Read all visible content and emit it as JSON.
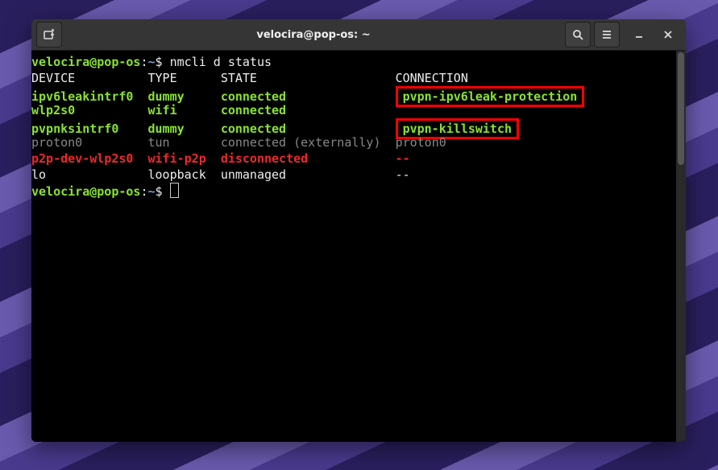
{
  "window": {
    "title": "velocira@pop-os: ~"
  },
  "prompt": {
    "user_host": "velocira@pop-os",
    "sep1": ":",
    "cwd": "~",
    "sep2": "$ "
  },
  "command": "nmcli d status",
  "headers": {
    "device": "DEVICE",
    "type": "TYPE",
    "state": "STATE",
    "connection": "CONNECTION"
  },
  "rows": [
    {
      "device": "ipv6leakintrf0",
      "type": "dummy",
      "state": "connected",
      "connection": "pvpn-ipv6leak-protection",
      "style": "green",
      "hl": true
    },
    {
      "device": "wlp2s0",
      "type": "wifi",
      "state": "connected",
      "connection": "",
      "style": "green",
      "hl": false
    },
    {
      "device": "pvpnksintrf0",
      "type": "dummy",
      "state": "connected",
      "connection": "pvpn-killswitch",
      "style": "green",
      "hl": true
    },
    {
      "device": "proton0",
      "type": "tun",
      "state": "connected (externally)",
      "connection": "proton0",
      "style": "dim",
      "hl": false
    },
    {
      "device": "p2p-dev-wlp2s0",
      "type": "wifi-p2p",
      "state": "disconnected",
      "connection": "--",
      "style": "red",
      "hl": false
    },
    {
      "device": "lo",
      "type": "loopback",
      "state": "unmanaged",
      "connection": "--",
      "style": "plain",
      "hl": false
    }
  ],
  "chart_data": {
    "type": "table",
    "title": "nmcli d status",
    "columns": [
      "DEVICE",
      "TYPE",
      "STATE",
      "CONNECTION"
    ],
    "rows": [
      [
        "ipv6leakintrf0",
        "dummy",
        "connected",
        "pvpn-ipv6leak-protection"
      ],
      [
        "wlp2s0",
        "wifi",
        "connected",
        ""
      ],
      [
        "pvpnksintrf0",
        "dummy",
        "connected",
        "pvpn-killswitch"
      ],
      [
        "proton0",
        "tun",
        "connected (externally)",
        "proton0"
      ],
      [
        "p2p-dev-wlp2s0",
        "wifi-p2p",
        "disconnected",
        "--"
      ],
      [
        "lo",
        "loopback",
        "unmanaged",
        "--"
      ]
    ]
  },
  "cols": {
    "device": 16,
    "type": 10,
    "state": 24
  }
}
